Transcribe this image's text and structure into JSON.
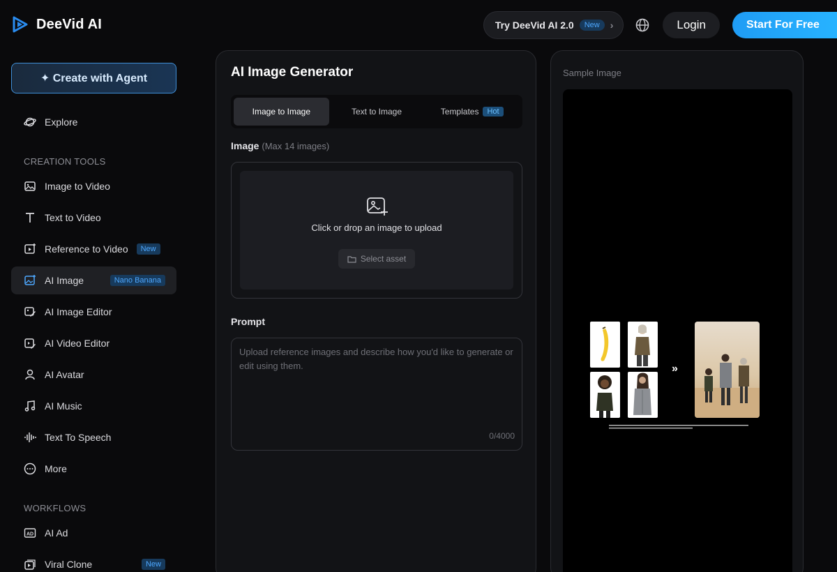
{
  "header": {
    "brand": "DeeVid AI",
    "try_label": "Try DeeVid AI 2.0",
    "try_badge": "New",
    "globe_icon": "globe-icon",
    "login_label": "Login",
    "start_label": "Start For Free"
  },
  "sidebar": {
    "agent_label": "✦ Create with Agent",
    "explore_label": "Explore",
    "section_creation": "CREATION TOOLS",
    "section_workflows": "WORKFLOWS",
    "items": [
      {
        "label": "Image to Video",
        "icon": "image-icon"
      },
      {
        "label": "Text to Video",
        "icon": "text-icon"
      },
      {
        "label": "Reference to Video",
        "icon": "video-plus-icon",
        "badge": "New"
      },
      {
        "label": "AI Image",
        "icon": "ai-image-icon",
        "badge": "Nano Banana",
        "active": true
      },
      {
        "label": "AI Image Editor",
        "icon": "image-edit-icon"
      },
      {
        "label": "AI Video Editor",
        "icon": "video-edit-icon"
      },
      {
        "label": "AI Avatar",
        "icon": "avatar-icon"
      },
      {
        "label": "AI Music",
        "icon": "music-icon"
      },
      {
        "label": "Text To Speech",
        "icon": "waveform-icon"
      },
      {
        "label": "More",
        "icon": "more-icon"
      }
    ],
    "workflows": [
      {
        "label": "AI Ad",
        "icon": "ad-icon"
      },
      {
        "label": "Viral Clone",
        "icon": "clone-icon",
        "badge": "New"
      }
    ]
  },
  "main": {
    "title": "AI Image Generator",
    "tabs": [
      {
        "label": "Image to Image",
        "active": true
      },
      {
        "label": "Text to Image"
      },
      {
        "label": "Templates",
        "badge": "Hot"
      }
    ],
    "image_label": "Image",
    "image_sub": "(Max 14 images)",
    "upload_text": "Click or drop an image to upload",
    "select_asset": "Select asset",
    "prompt_label": "Prompt",
    "prompt_placeholder": "Upload reference images and describe how you'd like to generate or edit using them.",
    "prompt_count": "0/4000"
  },
  "sample": {
    "label": "Sample Image",
    "arrow": "»"
  },
  "colors": {
    "accent": "#27b3ff",
    "badge_bg": "#173a5c",
    "badge_text": "#4ea8ff",
    "background": "#0a0a0c"
  }
}
